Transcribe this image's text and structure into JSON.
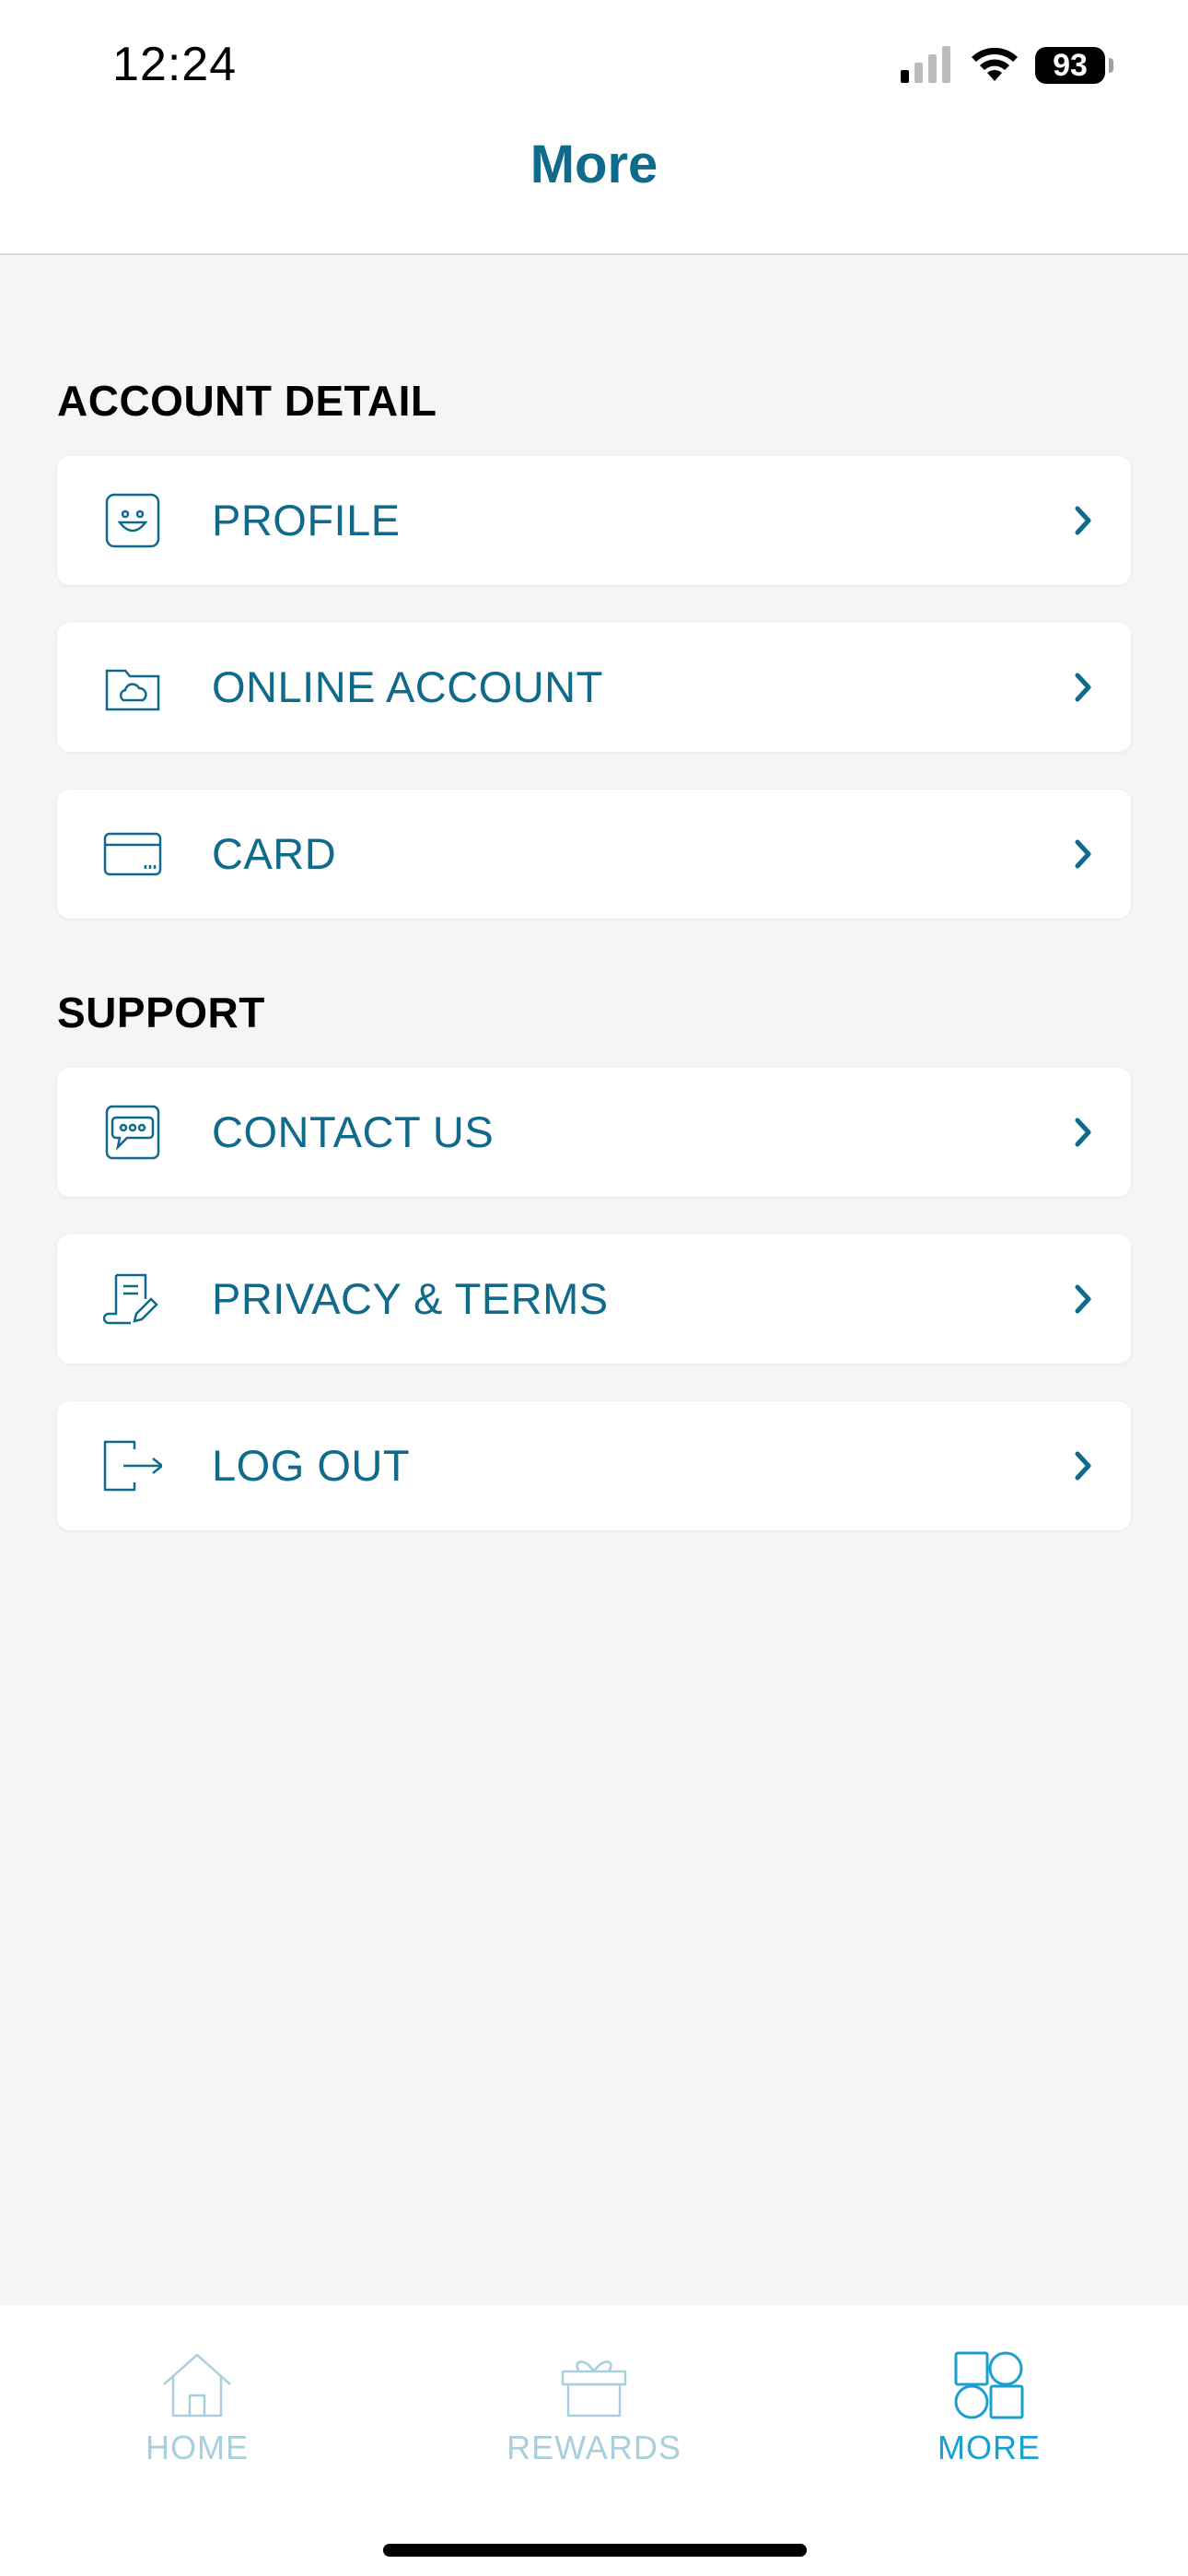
{
  "status_bar": {
    "time": "12:24",
    "battery": "93"
  },
  "header": {
    "title": "More"
  },
  "sections": [
    {
      "title": "ACCOUNT DETAIL",
      "items": [
        {
          "label": "PROFILE",
          "icon": "profile-face-icon"
        },
        {
          "label": "ONLINE ACCOUNT",
          "icon": "cloud-folder-icon"
        },
        {
          "label": "CARD",
          "icon": "card-icon"
        }
      ]
    },
    {
      "title": "SUPPORT",
      "items": [
        {
          "label": "CONTACT US",
          "icon": "chat-bubble-icon"
        },
        {
          "label": "PRIVACY & TERMS",
          "icon": "document-pen-icon"
        },
        {
          "label": "LOG OUT",
          "icon": "logout-icon"
        }
      ]
    }
  ],
  "tabbar": {
    "tabs": [
      {
        "label": "HOME",
        "icon": "home-icon",
        "active": false
      },
      {
        "label": "REWARDS",
        "icon": "gift-icon",
        "active": false
      },
      {
        "label": "MORE",
        "icon": "shapes-grid-icon",
        "active": true
      }
    ]
  },
  "colors": {
    "accent": "#0f6a8b",
    "tab_active": "#1aa0cf",
    "tab_inactive": "#a9cfdc",
    "background": "#f5f5f5"
  }
}
